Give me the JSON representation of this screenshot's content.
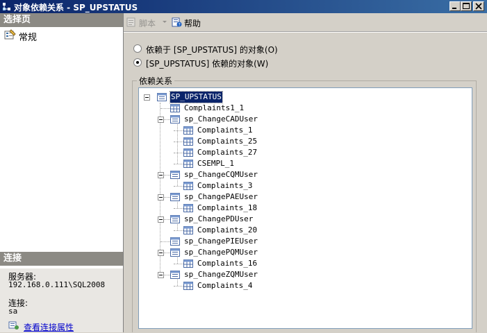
{
  "window": {
    "title": "对象依赖关系 - SP_UPSTATUS"
  },
  "sidebar": {
    "select_page_header": "选择页",
    "pages": [
      {
        "label": "常规"
      }
    ],
    "connection_header": "连接",
    "server_label": "服务器:",
    "server_value": "192.168.0.111\\SQL2008",
    "connection_label": "连接:",
    "connection_value": "sa",
    "view_connection_link": "查看连接属性"
  },
  "toolbar": {
    "script_label": "脚本",
    "help_label": "帮助"
  },
  "options": {
    "depends_on_label": "依赖于 [SP_UPSTATUS] 的对象(O)",
    "depended_by_label": "[SP_UPSTATUS] 依赖的对象(W)",
    "selected": "depended_by"
  },
  "dependencies": {
    "group_label": "依赖关系",
    "tree": [
      {
        "label": "SP_UPSTATUS",
        "level": 0,
        "expandable": true,
        "selected": true
      },
      {
        "label": "Complaints1_1",
        "level": 1,
        "expandable": false
      },
      {
        "label": "sp_ChangeCADUser",
        "level": 1,
        "expandable": true
      },
      {
        "label": "Complaints_1",
        "level": 2,
        "expandable": false
      },
      {
        "label": "Complaints_25",
        "level": 2,
        "expandable": false
      },
      {
        "label": "Complaints_27",
        "level": 2,
        "expandable": false
      },
      {
        "label": "CSEMPL_1",
        "level": 2,
        "expandable": false
      },
      {
        "label": "sp_ChangeCQMUser",
        "level": 1,
        "expandable": true
      },
      {
        "label": "Complaints_3",
        "level": 2,
        "expandable": false
      },
      {
        "label": "sp_ChangePAEUser",
        "level": 1,
        "expandable": true
      },
      {
        "label": "Complaints_18",
        "level": 2,
        "expandable": false
      },
      {
        "label": "sp_ChangePDUser",
        "level": 1,
        "expandable": true
      },
      {
        "label": "Complaints_20",
        "level": 2,
        "expandable": false
      },
      {
        "label": "sp_ChangePIEUser",
        "level": 1,
        "expandable": false
      },
      {
        "label": "sp_ChangePQMUser",
        "level": 1,
        "expandable": true
      },
      {
        "label": "Complaints_16",
        "level": 2,
        "expandable": false
      },
      {
        "label": "sp_ChangeZQMUser",
        "level": 1,
        "expandable": true
      },
      {
        "label": "Complaints_4",
        "level": 2,
        "expandable": false
      }
    ]
  },
  "icons": {
    "app": "dependency-icon",
    "page": "properties-page-icon",
    "script": "script-icon",
    "help": "help-icon",
    "proc": "stored-procedure-icon",
    "table": "table-icon",
    "link": "connection-properties-icon"
  }
}
